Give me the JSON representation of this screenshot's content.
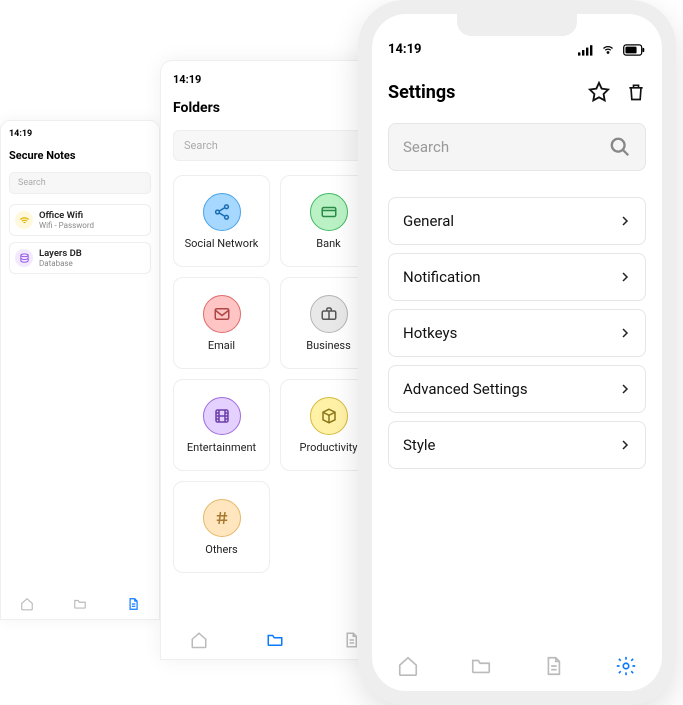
{
  "phone1": {
    "time": "14:19",
    "title": "Secure Notes",
    "search_placeholder": "Search",
    "items": [
      {
        "title": "Office Wifi",
        "subtitle": "Wifi - Password"
      },
      {
        "title": "Layers DB",
        "subtitle": "Database"
      }
    ]
  },
  "phone2": {
    "time": "14:19",
    "title": "Folders",
    "search_placeholder": "Search",
    "tiles": [
      {
        "label": "Social Network"
      },
      {
        "label": "Bank"
      },
      {
        "label": "Email"
      },
      {
        "label": "Business"
      },
      {
        "label": "Entertainment"
      },
      {
        "label": "Productivity"
      },
      {
        "label": "Others"
      }
    ]
  },
  "phone3": {
    "time": "14:19",
    "title": "Settings",
    "search_placeholder": "Search",
    "rows": [
      {
        "label": "General"
      },
      {
        "label": "Notification"
      },
      {
        "label": "Hotkeys"
      },
      {
        "label": "Advanced Settings"
      },
      {
        "label": "Style"
      }
    ]
  }
}
